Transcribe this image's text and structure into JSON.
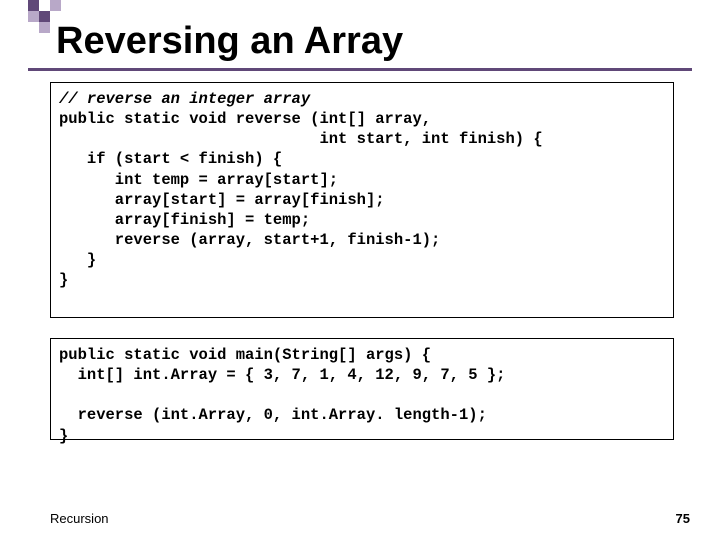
{
  "title": "Reversing an Array",
  "code": {
    "block1": {
      "l1": "// reverse an integer array",
      "l2": "public static void reverse (int[] array,",
      "l3": "                            int start, int finish) {",
      "l4": "   if (start < finish) {",
      "l5": "      int temp = array[start];",
      "l6": "      array[start] = array[finish];",
      "l7": "      array[finish] = temp;",
      "l8": "      reverse (array, start+1, finish-1);",
      "l9": "   }",
      "l10": "}"
    },
    "block2": {
      "l1": "public static void main(String[] args) {",
      "l2": "  int[] int.Array = { 3, 7, 1, 4, 12, 9, 7, 5 };",
      "l3": "",
      "l4": "  reverse (int.Array, 0, int.Array. length-1);",
      "l5": "}"
    }
  },
  "footer": {
    "left": "Recursion",
    "page": "75"
  }
}
